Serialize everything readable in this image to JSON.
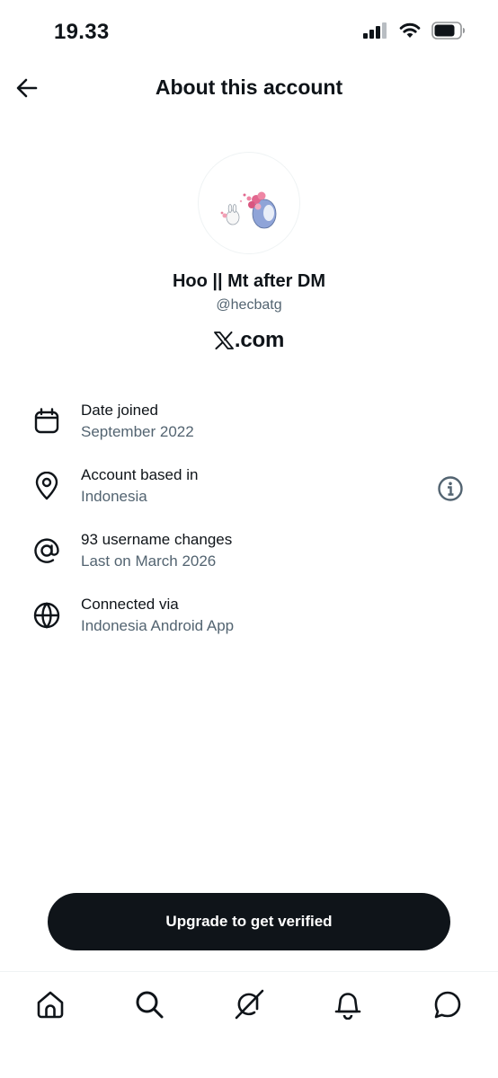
{
  "status_bar": {
    "time": "19.33",
    "icons": [
      "cellular-signal-icon",
      "wifi-icon",
      "battery-icon"
    ]
  },
  "header": {
    "back_icon": "arrow-left-icon",
    "title": "About this account"
  },
  "profile": {
    "display_name": "Hoo || Mt after DM",
    "handle": "@hecbatg",
    "site_logo": "x-logo-icon",
    "site_text": ".com"
  },
  "details": [
    {
      "icon": "calendar-icon",
      "label": "Date joined",
      "value": "September 2022"
    },
    {
      "icon": "location-pin-icon",
      "label": "Account based in",
      "value": "Indonesia",
      "help_icon": "info-circle-icon"
    },
    {
      "icon": "at-sign-icon",
      "label": "93 username changes",
      "value": "Last on March 2026"
    },
    {
      "icon": "globe-icon",
      "label": "Connected via",
      "value": "Indonesia Android App"
    }
  ],
  "cta": {
    "label": "Upgrade to get verified"
  },
  "tab_bar": {
    "items": [
      "home-icon",
      "search-icon",
      "grok-icon",
      "notifications-bell-icon",
      "messages-icon"
    ]
  },
  "colors": {
    "primary_text": "#0f1419",
    "secondary_text": "#536471",
    "button_bg": "#0f1419",
    "button_text": "#ffffff",
    "divider": "#eff3f4"
  }
}
